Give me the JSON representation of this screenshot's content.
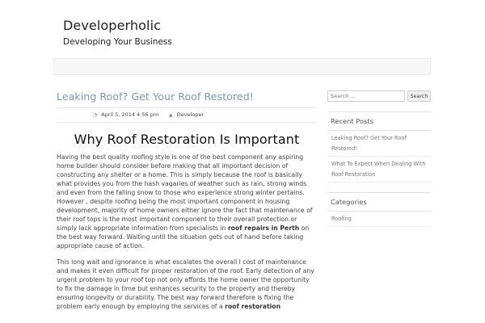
{
  "site": {
    "title": "Developerholic",
    "description": "Developing Your Business"
  },
  "post": {
    "title": "Leaking Roof? Get Your Roof Restored!",
    "date": "April 5, 2014 4:56 pm",
    "author": "Developer",
    "heading": "Why Roof Restoration Is Important",
    "p1_a": "Having the best quality roofing style is one of the best component any aspiring home builder should consider before making that all important decision of constructing any shelter or a home. This is simply because the roof is basically what provides you from the hash vagaries of weather such as rain, strong winds and even from the falling snow to those who experience strong winter pertains. However , despite roofing being the most important component in housing development, majority of home owners either ignore the fact that maintenance of their roof tops is the most important component to their overall protection or simply lack appropriate information from specialists in ",
    "p1_link": "roof repairs in Perth",
    "p1_b": " on the best way forward. Waiting until the situation gets out of hand before taking appropriate cause of action.",
    "p2_a": "This long wait and ignorance is what escalates the overall l cost of maintenance and makes it even difficult for proper restoration of the roof. Early detection of any urgent problem to your roof top not only affords the home owner the opportunity to fix the damage in time but enhances security to the property and thereby ensuring longevity or durability. The best way forward therefore is fixing the problem early enough by employing the services of a ",
    "p2_link": "roof restoration"
  },
  "sidebar": {
    "search": {
      "placeholder": "Search ...",
      "button_label": "Search"
    },
    "recent_posts": {
      "title": "Recent Posts",
      "items": [
        "Leaking Roof? Get Your Roof Restored!",
        "What To Expect When Dealing With Roof Restoration"
      ]
    },
    "categories": {
      "title": "Categories",
      "items": [
        "Roofing"
      ]
    }
  },
  "icons": {
    "date": "clock-icon",
    "author": "person-icon"
  }
}
